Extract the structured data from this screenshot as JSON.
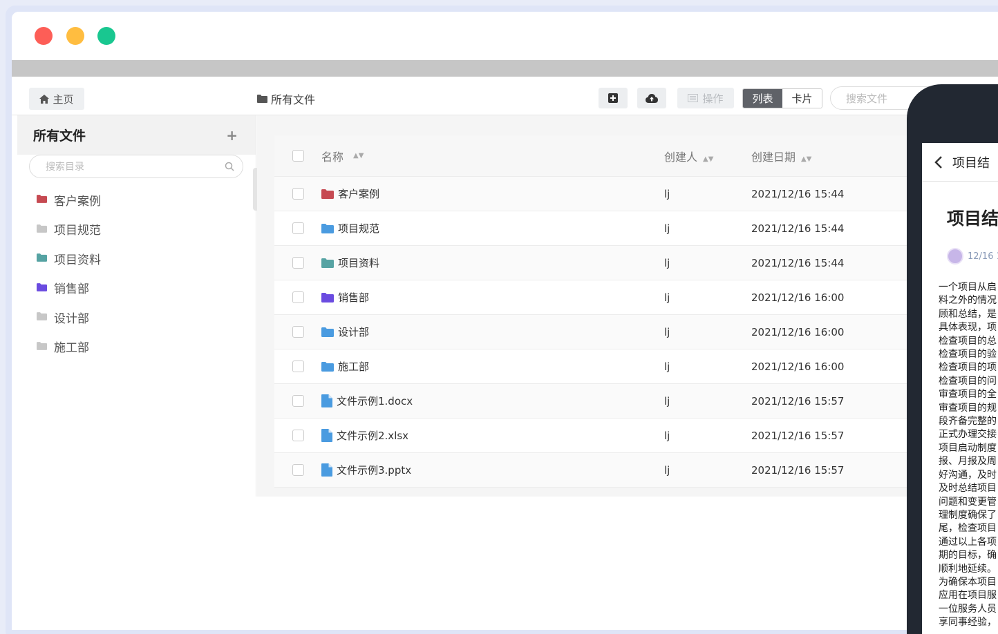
{
  "toolbar": {
    "home_label": "主页",
    "breadcrumb": "所有文件",
    "operate_label": "操作",
    "view_list": "列表",
    "view_card": "卡片",
    "search_placeholder": "搜索文件"
  },
  "sidebar": {
    "title": "所有文件",
    "search_placeholder": "搜索目录",
    "items": [
      {
        "label": "客户案例",
        "color": "#c64a52"
      },
      {
        "label": "项目规范",
        "color": "#c7c7c7"
      },
      {
        "label": "项目资料",
        "color": "#56a3a3"
      },
      {
        "label": "销售部",
        "color": "#6a4be0"
      },
      {
        "label": "设计部",
        "color": "#c7c7c7"
      },
      {
        "label": "施工部",
        "color": "#c7c7c7"
      }
    ]
  },
  "table": {
    "headers": {
      "name": "名称",
      "creator": "创建人",
      "date": "创建日期"
    },
    "rows": [
      {
        "name": "客户案例",
        "creator": "lj",
        "date": "2021/12/16 15:44",
        "type": "folder",
        "color": "#c64a52"
      },
      {
        "name": "项目规范",
        "creator": "lj",
        "date": "2021/12/16 15:44",
        "type": "folder",
        "color": "#4a9be0"
      },
      {
        "name": "项目资料",
        "creator": "lj",
        "date": "2021/12/16 15:44",
        "type": "folder",
        "color": "#56a3a3"
      },
      {
        "name": "销售部",
        "creator": "lj",
        "date": "2021/12/16 16:00",
        "type": "folder",
        "color": "#6a4be0"
      },
      {
        "name": "设计部",
        "creator": "lj",
        "date": "2021/12/16 16:00",
        "type": "folder",
        "color": "#4a9be0"
      },
      {
        "name": "施工部",
        "creator": "lj",
        "date": "2021/12/16 16:00",
        "type": "folder",
        "color": "#4a9be0"
      },
      {
        "name": "文件示例1.docx",
        "creator": "lj",
        "date": "2021/12/16 15:57",
        "type": "file",
        "color": "#4a9be0"
      },
      {
        "name": "文件示例2.xlsx",
        "creator": "lj",
        "date": "2021/12/16 15:57",
        "type": "file",
        "color": "#4a9be0"
      },
      {
        "name": "文件示例3.pptx",
        "creator": "lj",
        "date": "2021/12/16 15:57",
        "type": "file",
        "color": "#4a9be0"
      }
    ]
  },
  "phone": {
    "nav_title": "项目结",
    "doc_title": "项目结",
    "meta": "12/16 1",
    "body_lines": [
      "一个项目从启",
      "料之外的情况",
      "顾和总结，是",
      "具体表现，项",
      "检查项目的总",
      "检查项目的验",
      "检查项目的项",
      "检查项目的问",
      "审查项目的全",
      "审查项目的规",
      "段齐备完整的",
      "正式办理交接",
      "项目启动制度",
      "报、月报及周",
      "好沟通，及时",
      "及时总结项目",
      "问题和变更管",
      "理制度确保了",
      "尾，检查项目",
      "通过以上各项",
      "期的目标，确",
      "顺利地延续。",
      "为确保本项目",
      "应用在项目服",
      "一位服务人员",
      "享同事经验，"
    ]
  }
}
